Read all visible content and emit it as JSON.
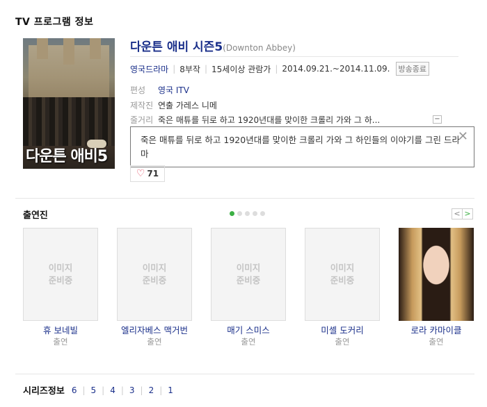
{
  "section_title": "TV 프로그램 정보",
  "poster": {
    "overlay_title": "다운튼 애비5"
  },
  "program": {
    "title": "다운튼 애비 시즌5",
    "original_title": "(Downton Abbey)",
    "genre": "영국드라마",
    "episodes": "8부작",
    "rating": "15세이상 관람가",
    "air_period": "2014.09.21.~2014.11.09.",
    "status_badge": "방송종료"
  },
  "info": {
    "network_label": "편성",
    "network_value": "영국 ITV",
    "staff_label": "제작진",
    "staff_value": "연출 가레스 니메",
    "synopsis_label": "줄거리",
    "synopsis_value": "죽은 매튜를 뒤로 하고 1920년대를 맞이한 크롤리 가와 그 하...",
    "collapse_label": "−"
  },
  "popup": {
    "text": "죽은 매튜를 뒤로 하고 1920년대를 맞이한 크롤리 가와 그 하인들의 이야기를 그린 드라마",
    "close": "✕"
  },
  "like": {
    "count": "71"
  },
  "cast": {
    "title": "출연진",
    "pager": {
      "prev": "<",
      "next": ">",
      "dots": 5,
      "active_dot": 1
    },
    "placeholder": "이미지\n준비중",
    "members": [
      {
        "name": "휴 보네빌",
        "role": "출연",
        "has_photo": false
      },
      {
        "name": "엘리자베스 맥거번",
        "role": "출연",
        "has_photo": false
      },
      {
        "name": "매기 스미스",
        "role": "출연",
        "has_photo": false
      },
      {
        "name": "미셸 도커리",
        "role": "출연",
        "has_photo": false
      },
      {
        "name": "로라 카마이클",
        "role": "출연",
        "has_photo": true
      }
    ]
  },
  "series": {
    "label": "시리즈정보",
    "items": [
      "6",
      "5",
      "4",
      "3",
      "2",
      "1"
    ]
  },
  "colors": {
    "link": "#1a2f8a",
    "accent_green": "#3cb044",
    "heart": "#e0415a"
  }
}
